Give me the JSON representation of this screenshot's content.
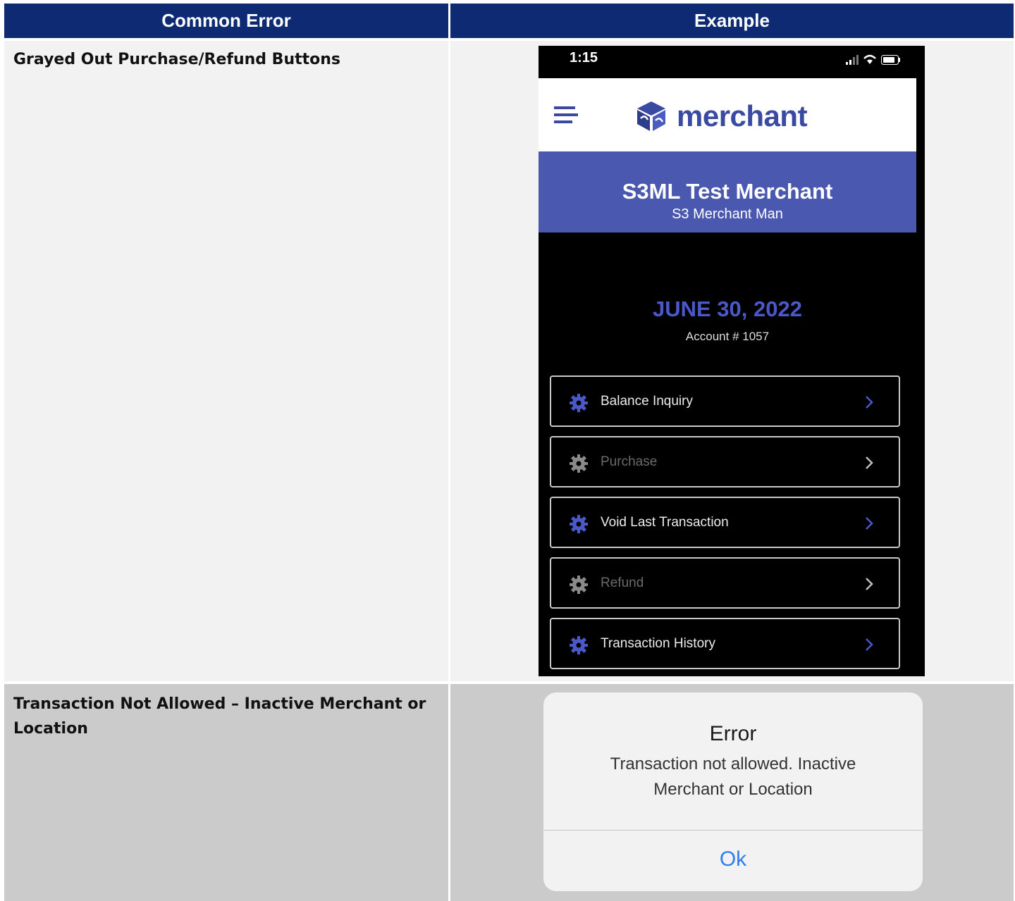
{
  "table": {
    "headers": [
      "Common Error",
      "Example"
    ],
    "rows": [
      {
        "label": "Grayed Out Purchase/Refund Buttons"
      },
      {
        "label": "Transaction Not Allowed – Inactive Merchant or Location"
      }
    ]
  },
  "phone": {
    "status_time": "1:15",
    "logo_text": "merchant",
    "merchant_name": "S3ML Test Merchant",
    "merchant_sub": "S3 Merchant Man",
    "date": "JUNE 30, 2022",
    "account": "Account # 1057",
    "menu": [
      {
        "label": "Balance Inquiry",
        "enabled": true
      },
      {
        "label": "Purchase",
        "enabled": false
      },
      {
        "label": "Void Last Transaction",
        "enabled": true
      },
      {
        "label": "Refund",
        "enabled": false
      },
      {
        "label": "Transaction History",
        "enabled": true
      }
    ]
  },
  "dialog": {
    "title": "Error",
    "message": "Transaction not allowed. Inactive Merchant or Location",
    "button": "Ok"
  },
  "colors": {
    "header_bg": "#0e2a72",
    "merchant_banner": "#4a58b0",
    "accent_blue": "#4a58c8",
    "disabled_gray": "#6a6a6a",
    "ios_blue": "#2e7ef0"
  }
}
